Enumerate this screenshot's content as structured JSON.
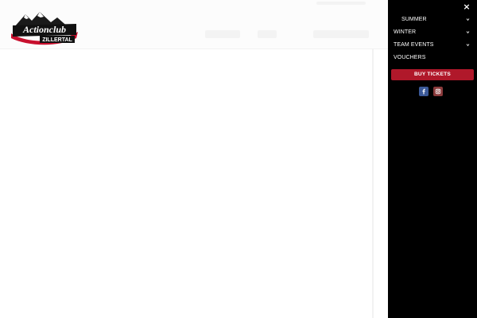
{
  "logo": {
    "line1": "Actionclub",
    "line2": "ZILLERTAL"
  },
  "offcanvas": {
    "close_label": "×",
    "menu": [
      {
        "label": "SUMMER",
        "has_submenu": true
      },
      {
        "label": "WINTER",
        "has_submenu": true
      },
      {
        "label": "TEAM EVENTS",
        "has_submenu": true
      },
      {
        "label": "VOUCHERS",
        "has_submenu": false
      }
    ],
    "buy_button": "BUY TICKETS",
    "social": [
      "facebook-icon",
      "instagram-icon"
    ]
  },
  "colors": {
    "menu_bg": "#000000",
    "buy_button_bg": "#b0182a",
    "facebook": "#3b5998",
    "instagram": "#8a3a3b"
  }
}
